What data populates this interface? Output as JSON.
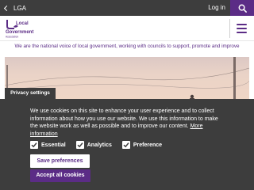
{
  "topbar": {
    "back_label": "LGA",
    "login_label": "Log in"
  },
  "header": {
    "logo_lines": [
      "Local",
      "Government",
      "Association"
    ]
  },
  "tagline": "We are the national voice of local government, working with councils to support, promote and improve",
  "privacy_tab": "Privacy settings",
  "cookie": {
    "message": "We use cookies on this site to enhance your user experience and to collect information about how you use our website. We use this information to make the website work as well as possible and to improve our content.",
    "more_info": "More information",
    "options": [
      {
        "label": "Essential",
        "checked": true
      },
      {
        "label": "Analytics",
        "checked": true
      },
      {
        "label": "Preference",
        "checked": true
      }
    ],
    "save_label": "Save preferences",
    "accept_label": "Accept all cookies"
  },
  "colors": {
    "brand_purple": "#5b2c86",
    "topbar_grey": "#3d3d3d",
    "panel_grey": "#3d3d3d"
  },
  "icons": {
    "search": "search-icon",
    "menu": "hamburger-menu-icon",
    "back": "chevron-left-icon",
    "check": "checkmark-icon"
  }
}
